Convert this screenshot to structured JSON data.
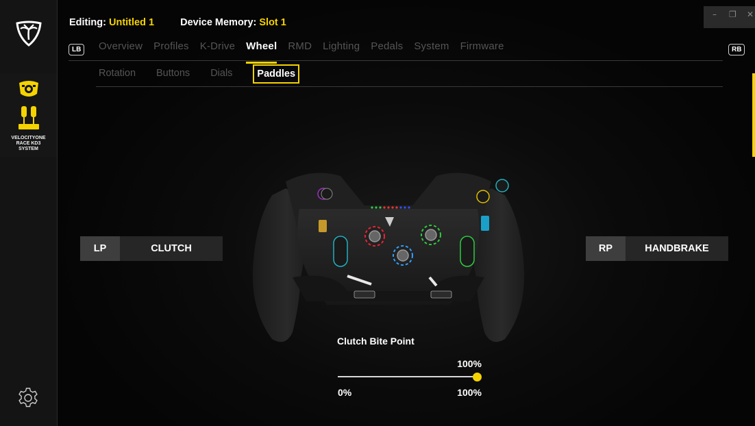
{
  "header": {
    "editing_label": "Editing:",
    "editing_value": "Untitled 1",
    "memory_label": "Device Memory:",
    "memory_value": "Slot 1"
  },
  "window_controls": {
    "minimize": "–",
    "maximize": "❐",
    "close": "✕"
  },
  "bumpers": {
    "left": "LB",
    "right": "RB"
  },
  "tabs": [
    "Overview",
    "Profiles",
    "K-Drive",
    "Wheel",
    "RMD",
    "Lighting",
    "Pedals",
    "System",
    "Firmware"
  ],
  "active_tab": "Wheel",
  "subtabs": [
    "Rotation",
    "Buttons",
    "Dials",
    "Paddles"
  ],
  "active_subtab": "Paddles",
  "sidebar": {
    "device_label": "VELOCITYONE\nRACE KD3\nSYSTEM",
    "icons": [
      "turtle-beach-logo-icon",
      "wheel-device-icon",
      "pedals-device-icon",
      "settings-gear-icon"
    ]
  },
  "paddles": {
    "left": {
      "key": "LP",
      "value": "CLUTCH"
    },
    "right": {
      "key": "RP",
      "value": "HANDBRAKE"
    }
  },
  "clutch_bite_point": {
    "title": "Clutch Bite Point",
    "current_value": "100%",
    "min_label": "0%",
    "max_label": "100%",
    "level": 1.0
  },
  "colors": {
    "accent": "#f5d300",
    "background": "#060606",
    "inactive_text": "#555555"
  }
}
